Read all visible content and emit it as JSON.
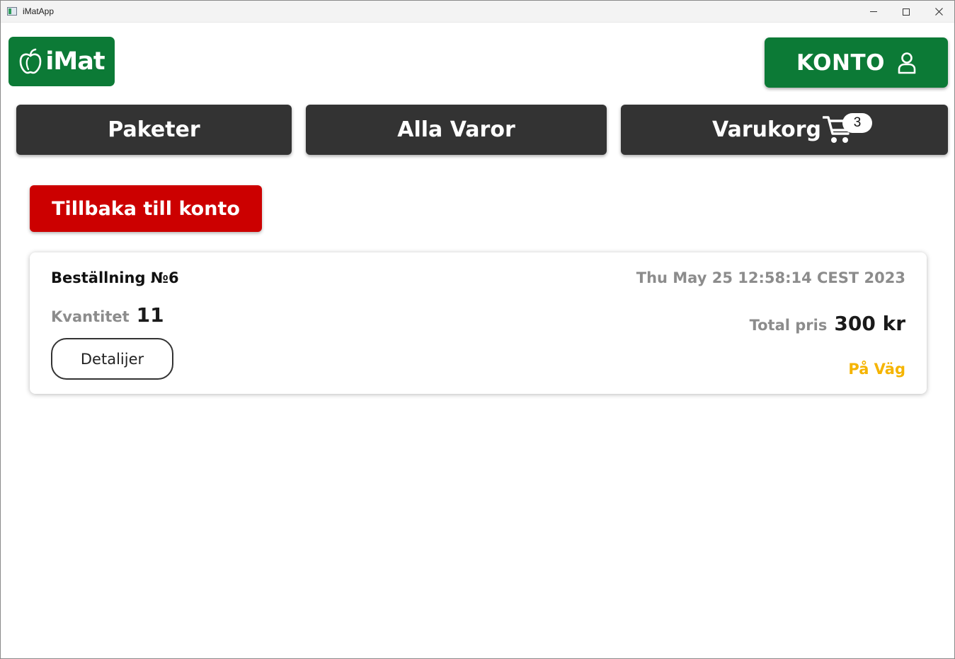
{
  "window": {
    "title": "iMatApp",
    "controls": {
      "minimize": "minimize-icon",
      "maximize": "maximize-icon",
      "close": "close-icon"
    }
  },
  "header": {
    "logo_text": "iMat",
    "logo_icon": "apple-icon",
    "account_label": "KONTO",
    "account_icon": "user-icon"
  },
  "nav": {
    "items": [
      {
        "label": "Paketer"
      },
      {
        "label": "Alla Varor"
      },
      {
        "label": "Varukorg",
        "icon": "cart-icon",
        "badge": "3"
      }
    ]
  },
  "back_button": {
    "label": "Tillbaka till konto"
  },
  "order": {
    "title": "Beställning №6",
    "date": "Thu May 25 12:58:14 CEST 2023",
    "quantity_label": "Kvantitet",
    "quantity_value": "11",
    "total_label": "Total pris",
    "total_value": "300 kr",
    "details_label": "Detalijer",
    "status": "På Väg"
  },
  "colors": {
    "brand_green": "#0c7a36",
    "nav_dark": "#333333",
    "back_red": "#cc0000",
    "status_yellow": "#f5b400",
    "muted_gray": "#8c8c8c"
  }
}
